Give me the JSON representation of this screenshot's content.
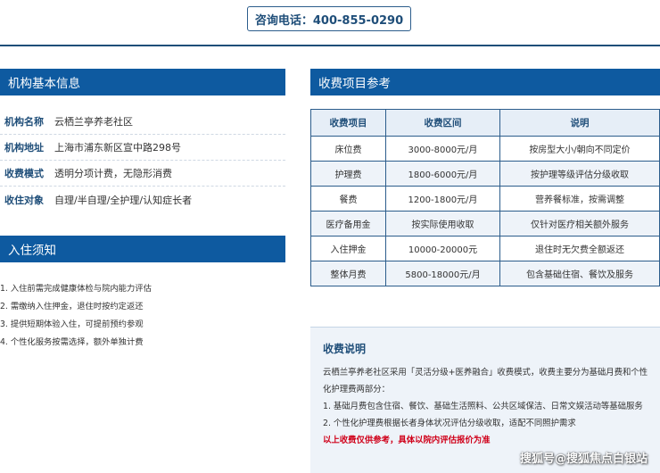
{
  "hotline": {
    "text": "咨询电话：400-855-0290"
  },
  "basic_info": {
    "title": "机构基本信息",
    "rows": [
      {
        "label": "机构名称",
        "value": "云栖兰亭养老社区"
      },
      {
        "label": "机构地址",
        "value": "上海市浦东新区宣中路298号"
      },
      {
        "label": "收费模式",
        "value": "透明分项计费，无隐形消费"
      },
      {
        "label": "收住对象",
        "value": "自理/半自理/全护理/认知症长者"
      }
    ]
  },
  "admission": {
    "title": "入住须知",
    "items": [
      "1. 入住前需完成健康体检与院内能力评估",
      "2. 需缴纳入住押金，退住时按约定返还",
      "3. 提供短期体验入住，可提前预约参观",
      "4. 个性化服务按需选择，额外单独计费"
    ]
  },
  "fees": {
    "title": "收费项目参考",
    "headers": [
      "收费项目",
      "收费区间",
      "说明"
    ],
    "rows": [
      [
        "床位费",
        "3000-8000元/月",
        "按房型大小/朝向不同定价"
      ],
      [
        "护理费",
        "1800-6000元/月",
        "按护理等级评估分级收取"
      ],
      [
        "餐费",
        "1200-1800元/月",
        "营养餐标准，按需调整"
      ],
      [
        "医疗备用金",
        "按实际使用收取",
        "仅针对医疗相关额外服务"
      ],
      [
        "入住押金",
        "10000-20000元",
        "退住时无欠费全额返还"
      ],
      [
        "整体月费",
        "5800-18000元/月",
        "包含基础住宿、餐饮及服务"
      ]
    ]
  },
  "fee_note": {
    "title": "收费说明",
    "p1": "云栖兰亭养老社区采用「灵活分级+医养融合」收费模式，收费主要分为基础月费和个性化护理费两部分：",
    "p2": "1. 基础月费包含住宿、餐饮、基础生活照料、公共区域保洁、日常文娱活动等基础服务",
    "p3": "2. 个性化护理费根据长者身体状况评估分级收取，适配不同照护需求",
    "warning": "以上收费仅供参考，具体以院内评估报价为准"
  },
  "watermark": "搜狐号@搜狐焦点白银站"
}
